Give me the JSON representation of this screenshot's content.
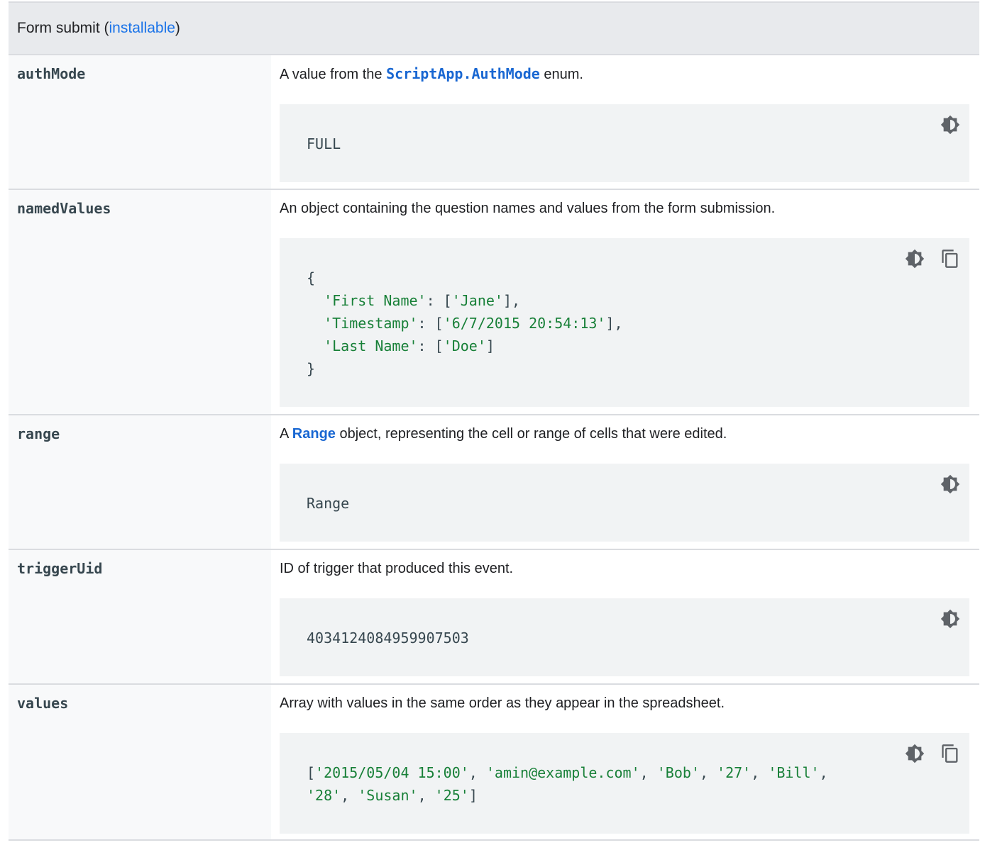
{
  "header": {
    "prefix": "Form submit (",
    "link": "installable",
    "suffix": ")"
  },
  "rows": [
    {
      "name": "authMode",
      "desc_before": "A value from the ",
      "desc_link": "ScriptApp.AuthMode",
      "desc_after": " enum.",
      "code": "FULL",
      "has_copy": false
    },
    {
      "name": "namedValues",
      "desc": "An object containing the question names and values from the form submission.",
      "code_lines": [
        {
          "pre": "{",
          "str": "",
          "post": ""
        },
        {
          "pre": "  ",
          "str": "'First Name'",
          "post": ": [",
          "str2": "'Jane'",
          "post2": "],"
        },
        {
          "pre": "  ",
          "str": "'Timestamp'",
          "post": ": [",
          "str2": "'6/7/2015 20:54:13'",
          "post2": "],"
        },
        {
          "pre": "  ",
          "str": "'Last Name'",
          "post": ": [",
          "str2": "'Doe'",
          "post2": "]"
        },
        {
          "pre": "}",
          "str": "",
          "post": ""
        }
      ],
      "has_copy": true
    },
    {
      "name": "range",
      "desc_before": "A ",
      "desc_link": "Range",
      "desc_after": " object, representing the cell or range of cells that were edited.",
      "code": "Range",
      "has_copy": false
    },
    {
      "name": "triggerUid",
      "desc": "ID of trigger that produced this event.",
      "code": "4034124084959907503",
      "has_copy": false
    },
    {
      "name": "values",
      "desc": "Array with values in the same order as they appear in the spreadsheet.",
      "code_values": [
        "'2015/05/04 15:00'",
        "'amin@example.com'",
        "'Bob'",
        "'27'",
        "'Bill'",
        "'28'",
        "'Susan'",
        "'25'"
      ],
      "has_copy": true
    }
  ],
  "icons": {
    "theme": "brightness-icon",
    "copy": "copy-icon"
  }
}
